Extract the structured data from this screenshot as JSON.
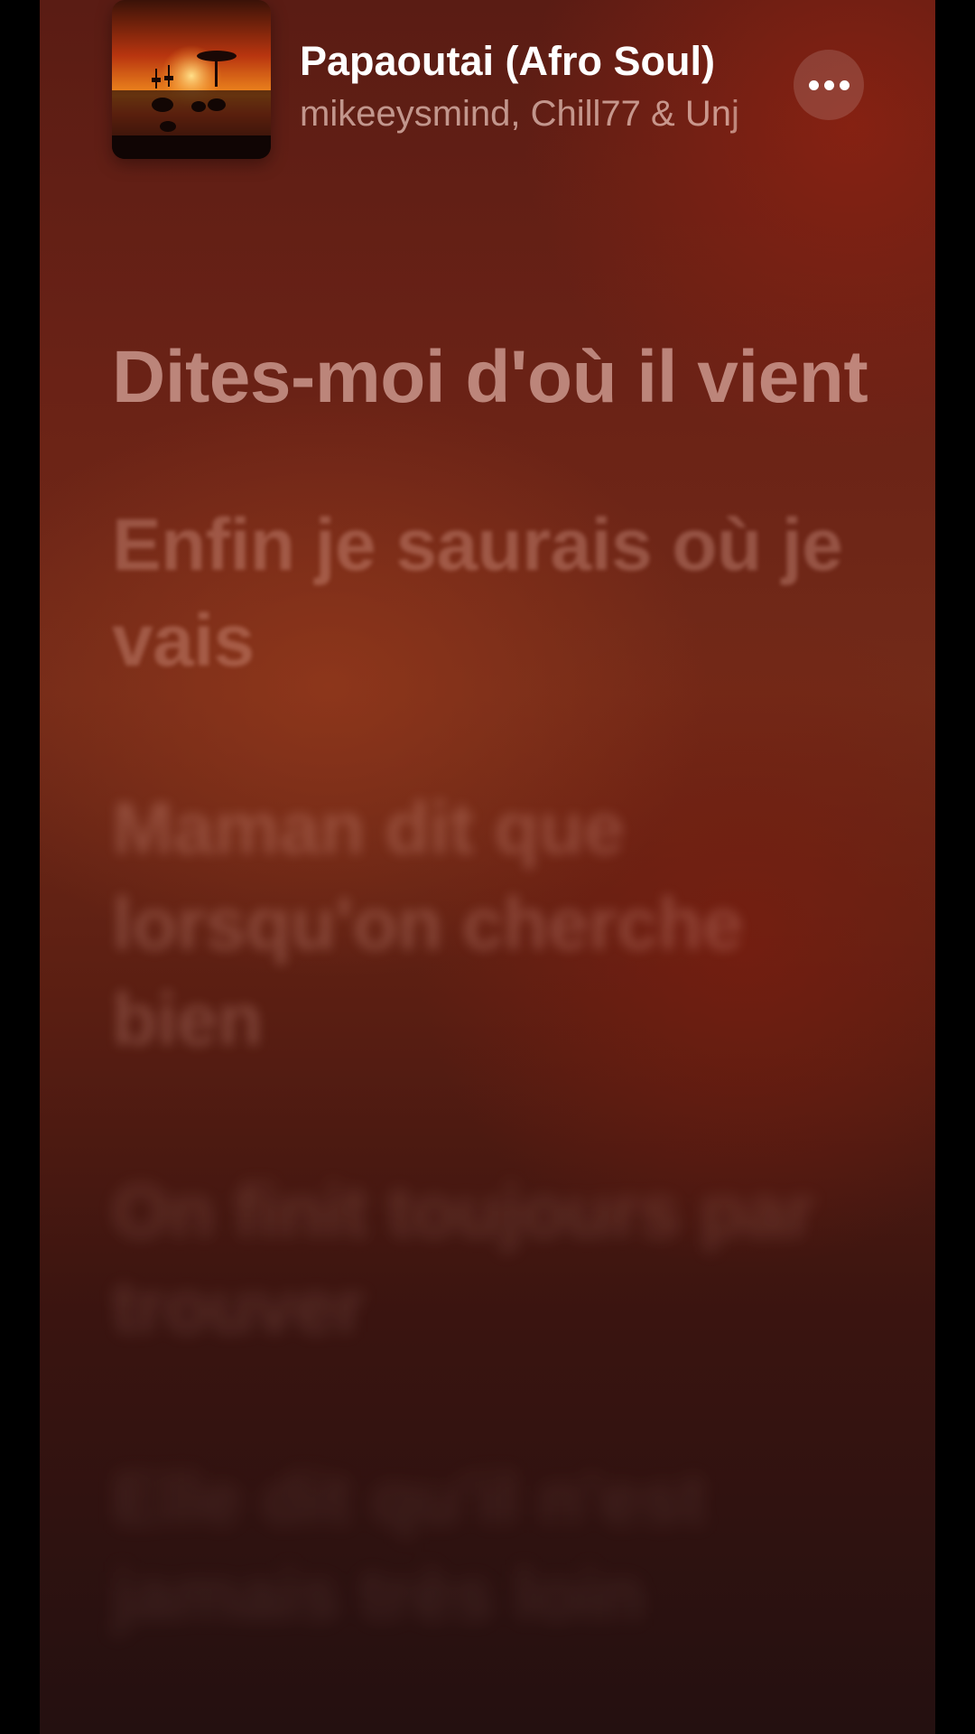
{
  "now_playing": {
    "title": "Papaoutai (Afro Soul)",
    "artist": "mikeeysmind, Chill77 & Unj",
    "artwork_icon": "savanna-sunset-artwork",
    "more_icon": "more-ellipsis-icon"
  },
  "lyrics": {
    "lines": [
      {
        "text": "Dites-moi d'où il vient",
        "state": "active"
      },
      {
        "text": "Enfin je saurais où je vais",
        "state": "upcoming"
      },
      {
        "text": "Maman dit que lorsqu'on cherche bien",
        "state": "upcoming"
      },
      {
        "text": "On finit toujours par trouver",
        "state": "upcoming"
      },
      {
        "text": "Elle dit qu'il n'est jamais très loin",
        "state": "upcoming"
      }
    ]
  },
  "colors": {
    "background_top": "#5a1c14",
    "background_bottom": "#241010",
    "title_text": "#ffffff"
  }
}
